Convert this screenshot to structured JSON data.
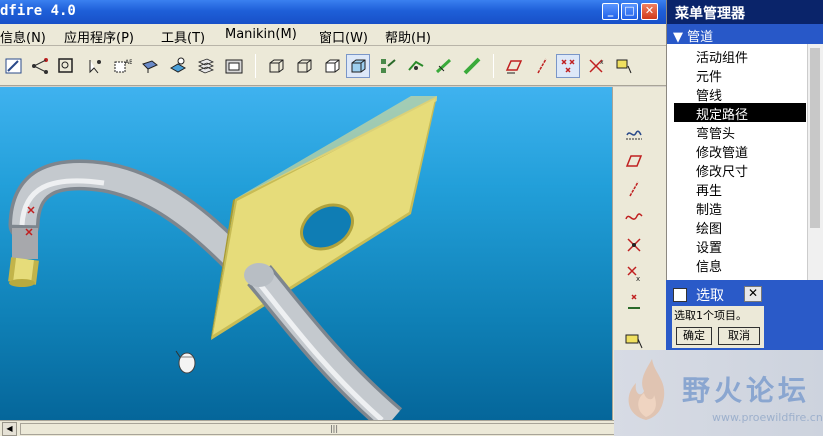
{
  "window": {
    "title": "dfire 4.0",
    "min_glyph": "_",
    "max_glyph": "□",
    "close_glyph": "✕"
  },
  "menubar": [
    "信息(N)",
    "应用程序(P)",
    "工具(T)",
    "Manikin(M)",
    "窗口(W)",
    "帮助(H)"
  ],
  "menu_manager": {
    "title": "菜单管理器",
    "group": "▼ 管道",
    "items": [
      "活动组件",
      "元件",
      "管线",
      "规定路径",
      "弯管头",
      "修改管道",
      "修改尺寸",
      "再生",
      "制造",
      "绘图",
      "设置",
      "信息"
    ],
    "selected_index": 3
  },
  "select_dialog": {
    "title": "选取",
    "close_glyph": "✕",
    "message": "选取1个项目。",
    "ok": "确定",
    "cancel": "取消"
  },
  "watermark": {
    "text": "野火论坛",
    "url": "www.proewildfire.cn"
  },
  "scrollbar": {
    "left": "◀",
    "right": "▶",
    "grip": "|||"
  },
  "colors": {
    "title_bar": "#1e5fd8",
    "viewport_top": "#3fb2ef",
    "viewport_bottom": "#05669a",
    "plate": "#e6dc7a",
    "pipe": "#c8ccd0",
    "selection": "#000000"
  }
}
